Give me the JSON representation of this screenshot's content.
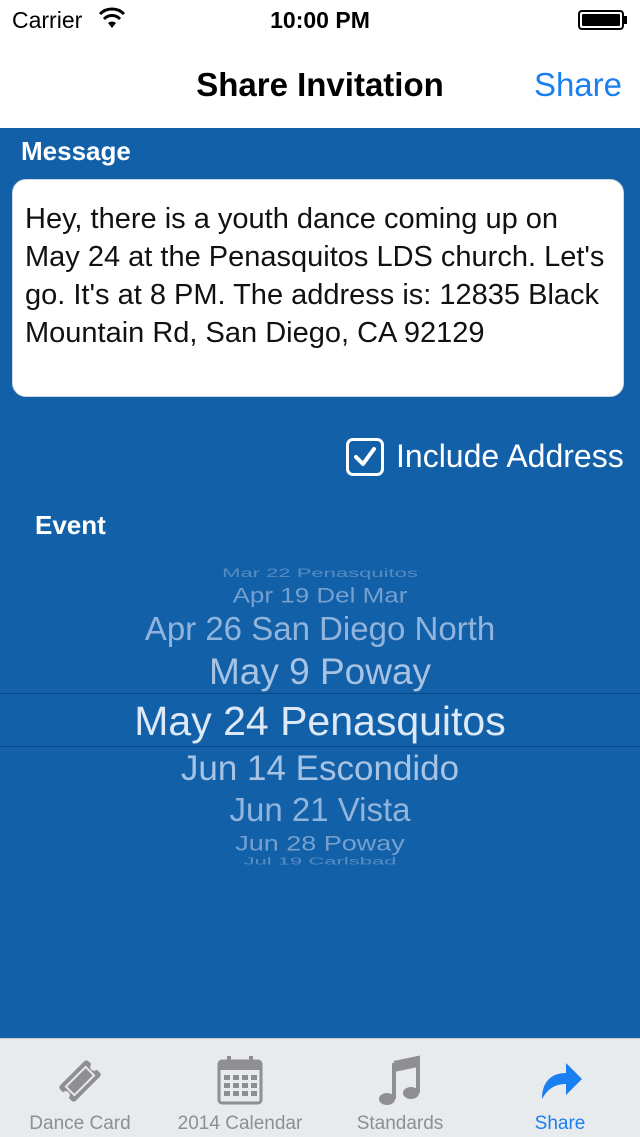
{
  "status_bar": {
    "carrier": "Carrier",
    "time": "10:00 PM"
  },
  "nav": {
    "title": "Share Invitation",
    "share_label": "Share"
  },
  "message": {
    "label": "Message",
    "text": "Hey, there is a youth dance coming up on May 24 at the Penasquitos LDS church. Let's go. It's at 8 PM. The address is: 12835 Black Mountain Rd, San Diego, CA 92129"
  },
  "include_address": {
    "label": "Include Address",
    "checked": true
  },
  "event": {
    "label": "Event",
    "options": [
      "Mar 22 Penasquitos",
      "Apr 19 Del Mar",
      "Apr 26 San Diego North",
      "May 9 Poway",
      "May 24 Penasquitos",
      "Jun 14 Escondido",
      "Jun 21 Vista",
      "Jun 28 Poway",
      "Jul 19 Carlsbad"
    ],
    "selected": "May 24 Penasquitos"
  },
  "tabs": [
    {
      "label": "Dance Card",
      "icon": "ticket-icon",
      "active": false
    },
    {
      "label": "2014 Calendar",
      "icon": "calendar-icon",
      "active": false
    },
    {
      "label": "Standards",
      "icon": "music-note-icon",
      "active": false
    },
    {
      "label": "Share",
      "icon": "share-arrow-icon",
      "active": true
    }
  ],
  "colors": {
    "background": "#1260a8",
    "accent": "#1a7ff0",
    "tab_inactive": "#8e8e93"
  }
}
